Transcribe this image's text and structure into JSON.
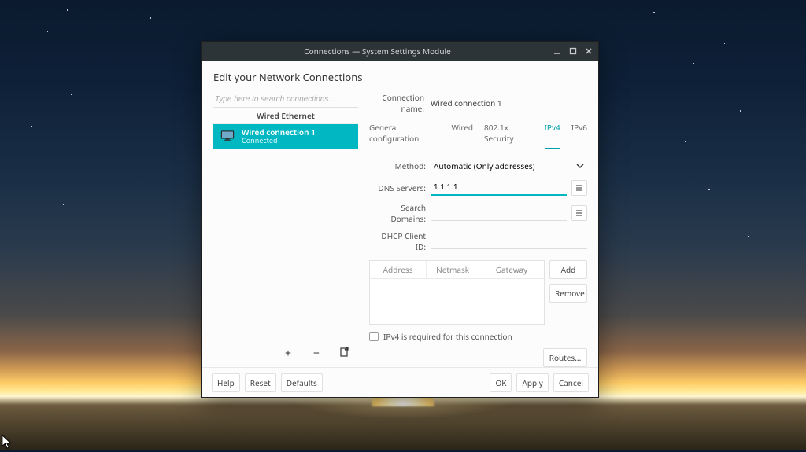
{
  "window": {
    "title": "Connections — System Settings Module",
    "heading": "Edit your Network Connections"
  },
  "sidebar": {
    "search_placeholder": "Type here to search connections...",
    "group_label": "Wired Ethernet",
    "items": [
      {
        "name": "Wired connection 1",
        "status": "Connected"
      }
    ]
  },
  "main": {
    "conn_name_label": "Connection name:",
    "conn_name_value": "Wired connection 1",
    "tabs": [
      {
        "label": "General configuration",
        "active": false
      },
      {
        "label": "Wired",
        "active": false
      },
      {
        "label": "802.1x Security",
        "active": false
      },
      {
        "label": "IPv4",
        "active": true
      },
      {
        "label": "IPv6",
        "active": false
      }
    ],
    "method_label": "Method:",
    "method_value": "Automatic (Only addresses)",
    "dns_label": "DNS Servers:",
    "dns_value": "1.1.1.1",
    "search_domains_label": "Search Domains:",
    "search_domains_value": "",
    "dhcp_label": "DHCP Client ID:",
    "dhcp_value": "",
    "addr_headers": {
      "address": "Address",
      "netmask": "Netmask",
      "gateway": "Gateway"
    },
    "add_label": "Add",
    "remove_label": "Remove",
    "required_label": "IPv4 is required for this connection",
    "routes_label": "Routes..."
  },
  "footer": {
    "help": "Help",
    "reset": "Reset",
    "defaults": "Defaults",
    "ok": "OK",
    "apply": "Apply",
    "cancel": "Cancel"
  }
}
